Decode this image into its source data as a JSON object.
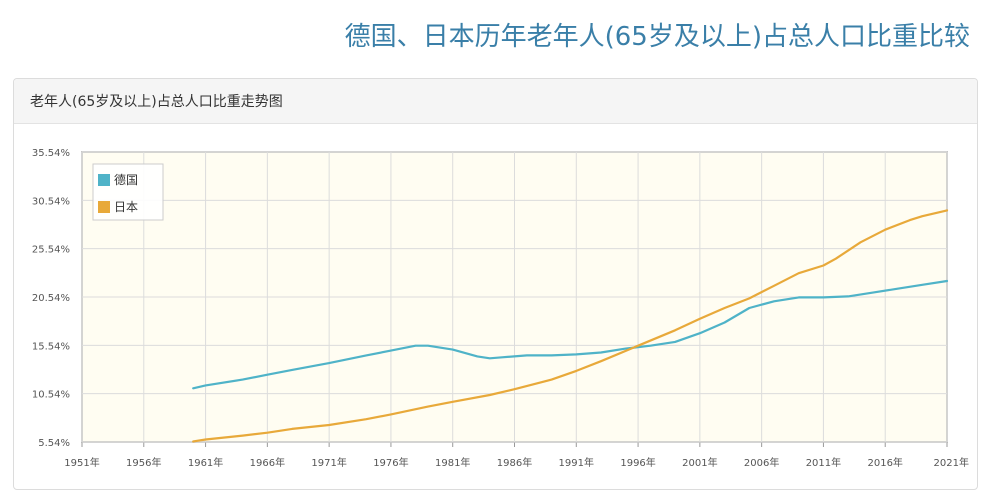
{
  "page": {
    "title": "德国、日本历年老年人(65岁及以上)占总人口比重比较"
  },
  "panel": {
    "title": "老年人(65岁及以上)占总人口比重走势图"
  },
  "colors": {
    "germany": "#4fb3c8",
    "japan": "#e8a93a",
    "plot_bg": "#fffdf2",
    "grid": "#dcdcdc",
    "frame": "#999999"
  },
  "chart_data": {
    "type": "line",
    "title": "",
    "xlabel": "",
    "ylabel": "",
    "xlim": [
      1951,
      2021
    ],
    "ylim": [
      5.54,
      35.54
    ],
    "y_ticks": [
      "35.54%",
      "30.54%",
      "25.54%",
      "20.54%",
      "15.54%",
      "10.54%",
      "5.54%"
    ],
    "y_tick_values": [
      35.54,
      30.54,
      25.54,
      20.54,
      15.54,
      10.54,
      5.54
    ],
    "x_ticks": [
      "1951年",
      "1956年",
      "1961年",
      "1966年",
      "1971年",
      "1976年",
      "1981年",
      "1986年",
      "1991年",
      "1996年",
      "2001年",
      "2006年",
      "2011年",
      "2016年",
      "2021年"
    ],
    "x_tick_values": [
      1951,
      1956,
      1961,
      1966,
      1971,
      1976,
      1981,
      1986,
      1991,
      1996,
      2001,
      2006,
      2011,
      2016,
      2021
    ],
    "legend_position": "top-left",
    "grid": true,
    "series": [
      {
        "name": "德国",
        "color": "#4fb3c8",
        "x": [
          1960,
          1961,
          1964,
          1966,
          1968,
          1971,
          1974,
          1976,
          1978,
          1979,
          1981,
          1983,
          1984,
          1985,
          1987,
          1989,
          1991,
          1993,
          1995,
          1997,
          1999,
          2001,
          2003,
          2005,
          2007,
          2009,
          2011,
          2013,
          2015,
          2017,
          2019,
          2021
        ],
        "y": [
          11.1,
          11.4,
          12.0,
          12.5,
          13.0,
          13.7,
          14.5,
          15.0,
          15.5,
          15.5,
          15.1,
          14.4,
          14.2,
          14.3,
          14.5,
          14.5,
          14.6,
          14.8,
          15.2,
          15.5,
          15.9,
          16.8,
          17.9,
          19.4,
          20.1,
          20.5,
          20.5,
          20.6,
          21.0,
          21.4,
          21.8,
          22.2
        ]
      },
      {
        "name": "日本",
        "color": "#e8a93a",
        "x": [
          1960,
          1961,
          1964,
          1966,
          1968,
          1971,
          1974,
          1976,
          1979,
          1981,
          1984,
          1986,
          1989,
          1991,
          1993,
          1996,
          1999,
          2001,
          2003,
          2005,
          2007,
          2009,
          2011,
          2012,
          2014,
          2016,
          2018,
          2019,
          2021
        ],
        "y": [
          5.6,
          5.8,
          6.2,
          6.5,
          6.9,
          7.3,
          7.9,
          8.4,
          9.2,
          9.7,
          10.4,
          11.0,
          12.0,
          12.9,
          13.9,
          15.5,
          17.1,
          18.3,
          19.4,
          20.4,
          21.7,
          23.0,
          23.8,
          24.5,
          26.2,
          27.5,
          28.5,
          28.9,
          29.5
        ]
      }
    ]
  }
}
